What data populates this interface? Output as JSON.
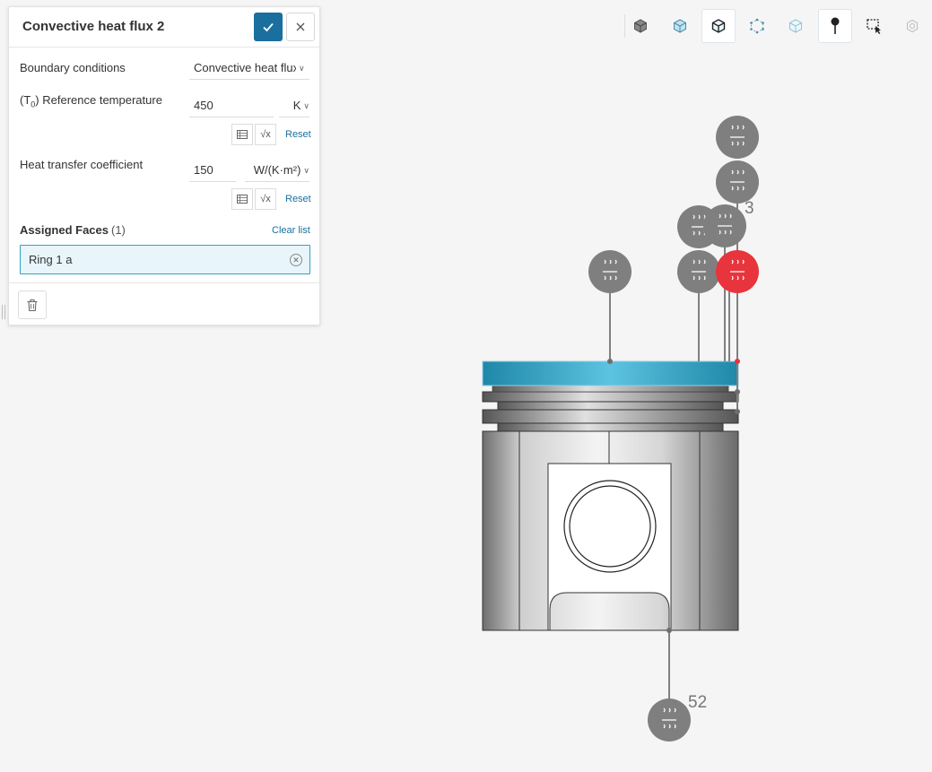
{
  "panel": {
    "title": "Convective heat flux 2",
    "boundary_conditions": {
      "label": "Boundary conditions",
      "value": "Convective heat flux"
    },
    "reference_temperature": {
      "label_prefix": "(T",
      "label_sub": "0",
      "label_suffix": ") Reference temperature",
      "value": "450",
      "unit": "K",
      "reset": "Reset"
    },
    "heat_transfer_coefficient": {
      "label": "Heat transfer coefficient",
      "value": "150",
      "unit": "W/(K·m²)",
      "reset": "Reset"
    },
    "assigned_faces": {
      "title": "Assigned Faces",
      "count": "(1)",
      "clear": "Clear list",
      "items": [
        "Ring 1 a"
      ]
    }
  },
  "toolbar": {
    "icons": [
      "cube-solid-icon",
      "cube-shaded-icon",
      "cube-outline-icon",
      "cube-points-icon",
      "cube-transparent-icon",
      "pin-icon",
      "box-select-icon",
      "settings-cube-icon"
    ]
  },
  "viewport": {
    "labels": {
      "top_count": "3",
      "bottom_count": "52"
    },
    "colors": {
      "marker": "#7f7f7f",
      "marker_selected": "#e8343c",
      "ring_highlight": "#2fa3c6",
      "accent": "#1a6f9e"
    }
  }
}
